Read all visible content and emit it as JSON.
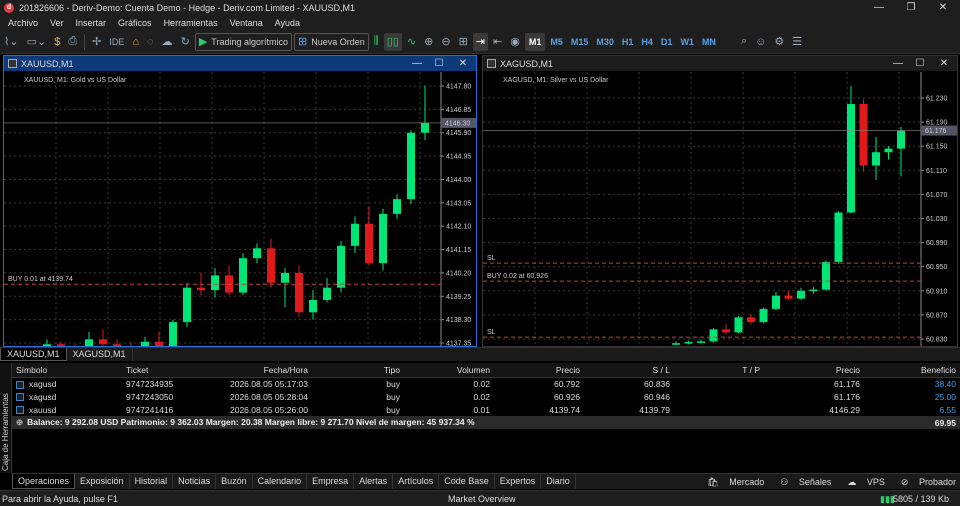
{
  "window": {
    "title": "201826606 - Deriv-Demo: Cuenta Demo - Hedge - Deriv.com Limited - XAUUSD,M1",
    "logo": "d",
    "min": "—",
    "restore": "❐",
    "close": "✕"
  },
  "menu": [
    "Archivo",
    "Ver",
    "Insertar",
    "Gráficos",
    "Herramientas",
    "Ventana",
    "Ayuda"
  ],
  "toolbar": {
    "ide": "IDE",
    "algo": "Trading algorítmico",
    "new_order": "Nueva Orden",
    "timeframes": [
      "M1",
      "M5",
      "M15",
      "M30",
      "H1",
      "H4",
      "D1",
      "W1",
      "MN"
    ],
    "active_tf": "M1"
  },
  "charts": [
    {
      "window_title": "XAUUSD,M1",
      "label": "XAUUSD, M1:  Gold vs US Dollar",
      "order_line": "BUY 0.01 at 4139.74",
      "ticks": [
        "4147.80",
        "4146.85",
        "4145.90",
        "4144.95",
        "4144.00",
        "4143.05",
        "4142.10",
        "4141.15",
        "4140.20",
        "4139.25",
        "4138.30",
        "4137.35"
      ],
      "price_tag": "4146.30",
      "candles": [
        [
          4137.2,
          4137.5,
          4136.9,
          4137.3
        ],
        [
          4137.3,
          4137.4,
          4137.0,
          4137.1
        ],
        [
          4137.1,
          4137.3,
          4136.8,
          4137.0
        ],
        [
          4137.0,
          4137.8,
          4136.9,
          4137.5
        ],
        [
          4137.5,
          4137.9,
          4137.2,
          4137.3
        ],
        [
          4137.3,
          4137.5,
          4137.0,
          4137.2
        ],
        [
          4137.2,
          4137.4,
          4137.0,
          4137.1
        ],
        [
          4137.1,
          4137.6,
          4136.9,
          4137.4
        ],
        [
          4137.4,
          4137.8,
          4137.0,
          4137.2
        ],
        [
          4137.2,
          4138.3,
          4137.1,
          4138.2
        ],
        [
          4138.2,
          4139.8,
          4138.0,
          4139.6
        ],
        [
          4139.6,
          4140.2,
          4139.3,
          4139.5
        ],
        [
          4139.5,
          4140.4,
          4139.2,
          4140.1
        ],
        [
          4140.1,
          4140.5,
          4139.3,
          4139.4
        ],
        [
          4139.4,
          4141.0,
          4139.3,
          4140.8
        ],
        [
          4140.8,
          4141.4,
          4140.6,
          4141.2
        ],
        [
          4141.2,
          4141.6,
          4139.6,
          4139.8
        ],
        [
          4139.8,
          4140.4,
          4138.8,
          4140.2
        ],
        [
          4140.2,
          4140.5,
          4138.4,
          4138.6
        ],
        [
          4138.6,
          4139.5,
          4138.3,
          4139.1
        ],
        [
          4139.1,
          4140.0,
          4139.0,
          4139.6
        ],
        [
          4139.6,
          4141.5,
          4139.4,
          4141.3
        ],
        [
          4141.3,
          4142.5,
          4141.0,
          4142.2
        ],
        [
          4142.2,
          4142.9,
          4140.5,
          4140.6
        ],
        [
          4140.6,
          4142.8,
          4140.3,
          4142.6
        ],
        [
          4142.6,
          4143.4,
          4142.4,
          4143.2
        ],
        [
          4143.2,
          4146.0,
          4143.0,
          4145.9
        ],
        [
          4145.9,
          4147.8,
          4145.6,
          4146.3
        ]
      ]
    },
    {
      "window_title": "XAGUSD,M1",
      "label": "XAGUSD, M1:  Silver vs US Dollar",
      "sl": "SL",
      "order_line": "BUY 0.02 at 60.926",
      "ticks": [
        "61.230",
        "61.190",
        "61.150",
        "61.110",
        "61.070",
        "61.030",
        "60.990",
        "60.950",
        "60.910",
        "60.870",
        "60.830"
      ],
      "price_tag": "61.176",
      "candles": [
        [
          60.822,
          60.826,
          60.82,
          60.823
        ],
        [
          60.823,
          60.827,
          60.821,
          60.825
        ],
        [
          60.825,
          60.829,
          60.823,
          60.826
        ],
        [
          60.826,
          60.848,
          60.824,
          60.846
        ],
        [
          60.846,
          60.854,
          60.838,
          60.841
        ],
        [
          60.841,
          60.868,
          60.84,
          60.866
        ],
        [
          60.866,
          60.872,
          60.854,
          60.858
        ],
        [
          60.858,
          60.882,
          60.856,
          60.88
        ],
        [
          60.88,
          60.908,
          60.878,
          60.902
        ],
        [
          60.902,
          60.91,
          60.895,
          60.897
        ],
        [
          60.897,
          60.915,
          60.895,
          60.91
        ],
        [
          60.91,
          60.916,
          60.905,
          60.912
        ],
        [
          60.912,
          60.96,
          60.91,
          60.958
        ],
        [
          60.958,
          61.042,
          60.955,
          61.04
        ],
        [
          61.04,
          61.25,
          61.038,
          61.22
        ],
        [
          61.22,
          61.228,
          61.108,
          61.118
        ],
        [
          61.118,
          61.165,
          61.094,
          61.14
        ],
        [
          61.14,
          61.15,
          61.128,
          61.146
        ],
        [
          61.146,
          61.182,
          61.1,
          61.176
        ]
      ]
    }
  ],
  "chart_tabs": [
    "XAUUSD,M1",
    "XAGUSD,M1"
  ],
  "trade": {
    "headers": [
      "Símbolo",
      "Ticket",
      "Fecha/Hora",
      "Tipo",
      "Volumen",
      "Precio",
      "S / L",
      "T / P",
      "Precio",
      "Beneficio"
    ],
    "rows": [
      {
        "symbol": "xagusd",
        "ticket": "9747234935",
        "time": "2026.08.05 05:17:03",
        "type": "buy",
        "vol": "0.02",
        "price": "60.792",
        "sl": "60.836",
        "tp": "",
        "cur": "61.176",
        "profit": "38.40"
      },
      {
        "symbol": "xagusd",
        "ticket": "9747243050",
        "time": "2026.08.05 05:28:04",
        "type": "buy",
        "vol": "0.02",
        "price": "60.926",
        "sl": "60.946",
        "tp": "",
        "cur": "61.176",
        "profit": "25.00"
      },
      {
        "symbol": "xauusd",
        "ticket": "9747241416",
        "time": "2026.08.05 05:26:00",
        "type": "buy",
        "vol": "0.01",
        "price": "4139.74",
        "sl": "4139.79",
        "tp": "",
        "cur": "4146.29",
        "profit": "6.55"
      }
    ],
    "balance": "Balance: 9 292.08 USD  Patrimonio: 9 362.03  Margen: 20.38  Margen libre: 9 271.70  Nivel de margen: 45 937.34 %",
    "total": "69.95"
  },
  "toolbox_label": "Caja de Herramientas",
  "bottom_tabs": [
    "Operaciones",
    "Exposición",
    "Historial",
    "Noticias",
    "Buzón",
    "Calendario",
    "Empresa",
    "Alertas",
    "Artículos",
    "Code Base",
    "Expertos",
    "Diario"
  ],
  "bottom_right": [
    "Mercado",
    "Señales",
    "VPS",
    "Probador"
  ],
  "status": {
    "help": "Para abrir la Ayuda, pulse F1",
    "market": "Market Overview",
    "traffic": "5805 / 139 Kb"
  },
  "colors": {
    "bull": "#00e676",
    "bear": "#e01a1a",
    "order_line": "#c04040",
    "grid": "#3a3a3a"
  }
}
